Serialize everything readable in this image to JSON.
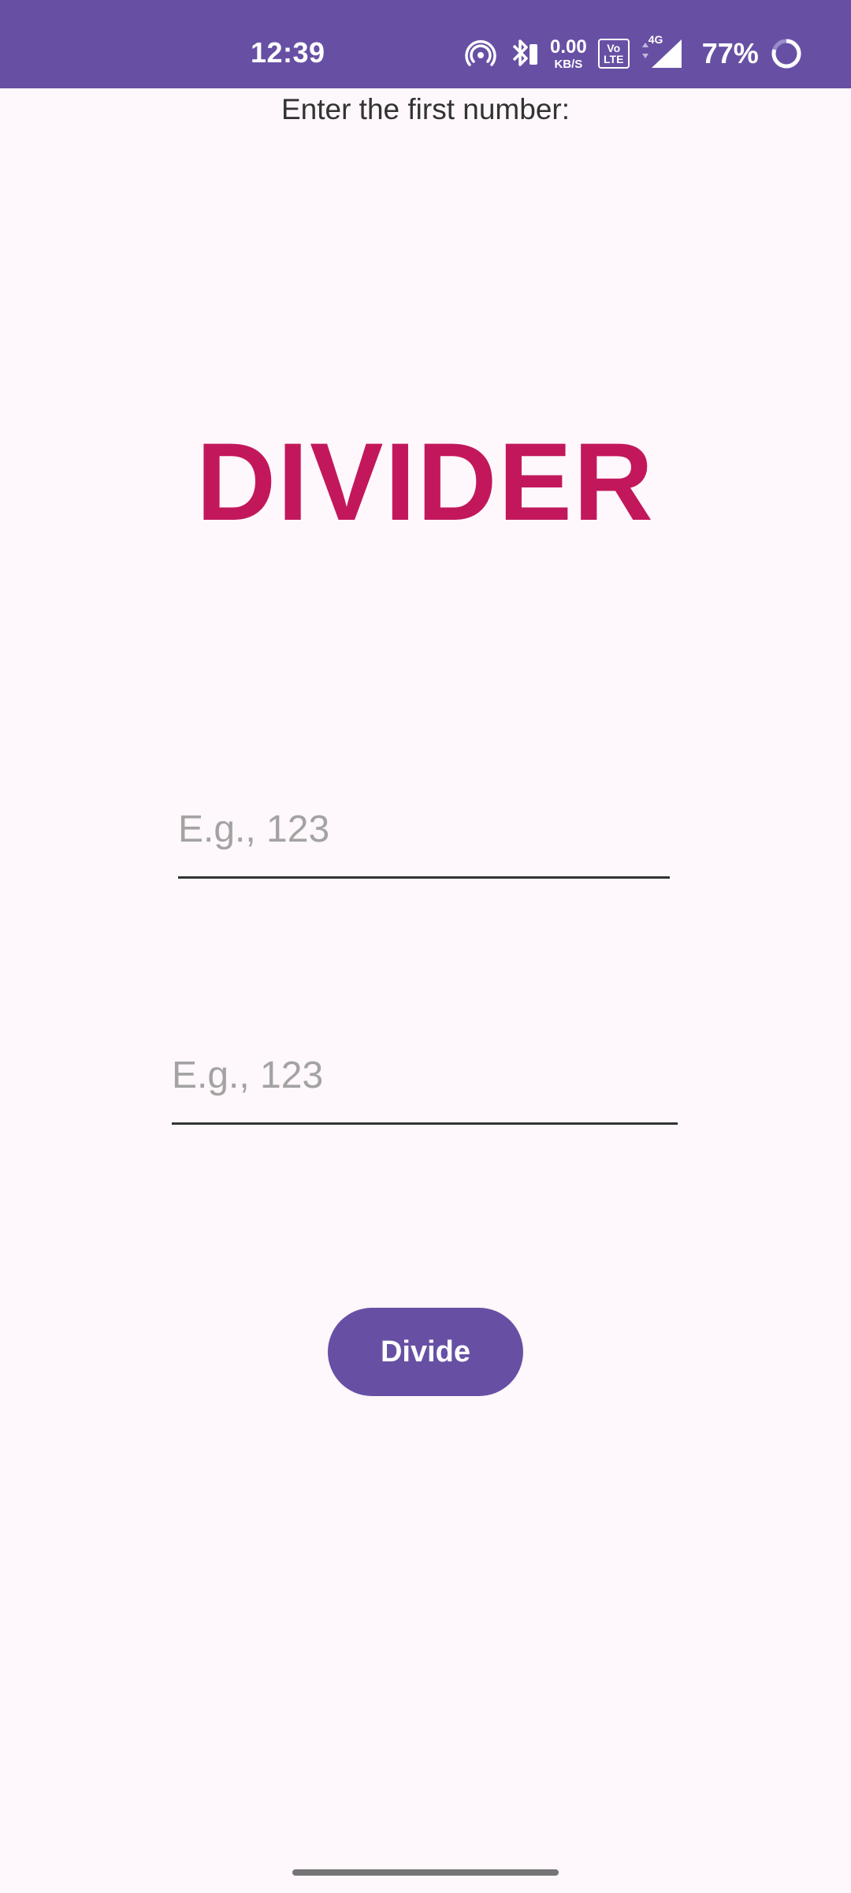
{
  "status_bar": {
    "time": "12:39",
    "net_speed_value": "0.00",
    "net_speed_unit": "KB/S",
    "volte_label": "Vo LTE",
    "network_type": "4G",
    "battery_percent": "77%",
    "icons": [
      "hotspot-icon",
      "bluetooth-icon",
      "volte-icon",
      "signal-icon",
      "battery-ring-icon"
    ]
  },
  "main": {
    "prompt_label": "Enter the first number:",
    "title": "DIVIDER",
    "first_input": {
      "value": "",
      "placeholder": "E.g., 123"
    },
    "second_input": {
      "value": "",
      "placeholder": "E.g., 123"
    },
    "divide_button_label": "Divide"
  },
  "colors": {
    "primary": "#6750A4",
    "title": "#C2185B",
    "background": "#FEF7FB"
  }
}
